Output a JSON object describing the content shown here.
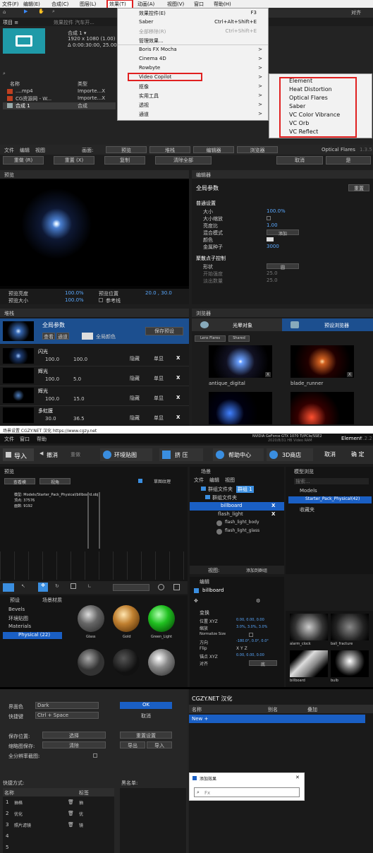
{
  "ae": {
    "menubar": [
      "文件(F)",
      "编辑(E)",
      "合成(C)",
      "图层(L)",
      "效果(T)",
      "动画(A)",
      "视图(V)",
      "窗口",
      "帮助(H)"
    ],
    "align_label": "对齐",
    "panel_tabs": [
      "项目 ≡",
      "效果控件 汽车开..."
    ],
    "comp_name": "合成 1 ▾",
    "comp_info1": "1920 x 1080 (1.00)",
    "comp_info2": "Δ 0:00:30:00, 25.00 fps",
    "search_glyph": "⌕",
    "col_name": "名称",
    "col_type": "类型",
    "rows": [
      {
        "n": "....mp4",
        "t": "Importe...X"
      },
      {
        "n": "CG资源网 - W...",
        "t": "Importe...X"
      },
      {
        "n": "合成 1",
        "t": "合成"
      }
    ],
    "effect_menu": [
      {
        "l": "效果控件(E)",
        "s": "F3"
      },
      {
        "l": "Saber",
        "s": "Ctrl+Alt+Shift+E"
      },
      {
        "l": "全部移除(R)",
        "s": "Ctrl+Shift+E"
      },
      {
        "l": "管理效果...",
        "s": ""
      },
      {
        "l": "Boris FX Mocha",
        "s": ">"
      },
      {
        "l": "Cinema 4D",
        "s": ">"
      },
      {
        "l": "Rowbyte",
        "s": ">"
      },
      {
        "l": "Video Copilot",
        "s": ">"
      },
      {
        "l": "抠像",
        "s": ">"
      },
      {
        "l": "实用工具",
        "s": ">"
      },
      {
        "l": "透视",
        "s": ">"
      },
      {
        "l": "通道",
        "s": ">"
      }
    ],
    "submenu": [
      "Element",
      "Heat Distortion",
      "Optical Flares",
      "Saber",
      "VC Color Vibrance",
      "VC Orb",
      "VC Reflect"
    ]
  },
  "of": {
    "menu": [
      "文件",
      "编辑",
      "视图"
    ],
    "topbar": [
      "画面:",
      "预览",
      "堆栈",
      "编辑器",
      "浏览器"
    ],
    "brand": "Optical Flares",
    "ver": "1.3.5",
    "btns": [
      "重做 (R)",
      "重置 (X)",
      "复制",
      "清除全部",
      "取消",
      "是"
    ],
    "preview_title": "预览",
    "stats": [
      {
        "l": "预览亮度",
        "v": "100.0%"
      },
      {
        "l": "预览位置",
        "v": "20.0 , 30.0"
      },
      {
        "l": "预览大小",
        "v": "100.0%"
      },
      {
        "l": "参考线",
        "v": ""
      }
    ],
    "stack_title": "堆栈",
    "global": {
      "label": "全局参数",
      "b1": "查看",
      "b2": "通道",
      "color": "全局颜色",
      "save": "保存预设"
    },
    "layers": [
      {
        "n": "闪光",
        "a": "100.0",
        "b": "100.0"
      },
      {
        "n": "辉光",
        "a": "100.0",
        "b": "5.0"
      },
      {
        "n": "辉光",
        "a": "100.0",
        "b": "15.0"
      },
      {
        "n": "多虹膜",
        "a": "30.0",
        "b": "36.5"
      }
    ],
    "layer_btns": {
      "hide": "隐藏",
      "solo": "单显",
      "x": "X"
    },
    "editor_title": "编辑器",
    "gp": "全局参数",
    "reset": "重置",
    "basic": "普通设置",
    "basic_rows": [
      {
        "l": "大小",
        "v": "100.0%"
      },
      {
        "l": "大小缩放",
        "v": ""
      },
      {
        "l": "亮度比",
        "v": "1.00"
      },
      {
        "l": "混合模式",
        "v": "添加"
      },
      {
        "l": "颜色",
        "v": ""
      },
      {
        "l": "金属种子",
        "v": "3000"
      }
    ],
    "light": "聚散点子控制",
    "light_rows": [
      {
        "l": "形状",
        "v": "圆"
      },
      {
        "l": "开始强度",
        "v": "25.0"
      },
      {
        "l": "淡出数量",
        "v": "25.0"
      }
    ],
    "browser_title": "浏览器",
    "tab1": "光晕对象",
    "tab2": "预设浏览器",
    "chips": [
      "Lens Flares",
      "Shared"
    ],
    "thumbs": [
      "antique_digital",
      "blade_runner",
      "",
      ""
    ]
  },
  "el": {
    "title": "场景设置 CGZY.NET 汉化 https://www.cgzy.net",
    "gpu": "NVIDIA GeForce GTX 1070 Ti/PCIe/SSE2",
    "gpu2": "2020/8/31 HB Video RAM",
    "menu": [
      "文件",
      "窗口",
      "帮助"
    ],
    "brand": "Element",
    "brand_ver": "2.2.2",
    "toolbar": [
      "导入",
      "撤消",
      "重做",
      "环境贴图",
      "挤 压",
      "帮助中心",
      "3D商店",
      "取消",
      "确 定"
    ],
    "preview": "预览",
    "dd1": "查看模",
    "dd2": "视角",
    "dd3": "草图纹理",
    "info": [
      "模型: Models/Starter_Pack_Physical/billboard.obj",
      "顶点: 37576",
      "面数: 9192"
    ],
    "scene": "场景",
    "scene_menu": [
      "文件",
      "编辑",
      "视图"
    ],
    "group1": "群组文件夹",
    "group1b": "群组 1",
    "group2": "群组文件夹",
    "bb": "billboard",
    "fl": "flash_light",
    "flb": "flash_light_body",
    "flg": "flash_light_glass",
    "view_label": "视图:",
    "add_group": "添加到群组",
    "model_browser": "模型浏览",
    "search_placeholder": "搜索...",
    "tree": [
      "Models",
      "Starter_Pack_Physical(42)",
      "收藏夹"
    ],
    "mat_tabs": [
      "预设",
      "场景材质"
    ],
    "mat_tree": [
      "Bevels",
      "环境贴图",
      "Materials",
      "Physical (22)"
    ],
    "mats": [
      "Glass",
      "Gold",
      "Green_Light",
      "",
      "",
      ""
    ],
    "edit": "编辑",
    "edit_item": "billboard",
    "transform": "变换",
    "props": [
      {
        "l": "位置 XYZ",
        "v": "0.00, 0.00, 0.00"
      },
      {
        "l": "缩放",
        "v": "3.0%, 3.0%, 3.0%"
      },
      {
        "l": "Normalize Size",
        "v": ""
      },
      {
        "l": "方向",
        "v": "-180.0°, 0.0°, 0.0°"
      },
      {
        "l": "Flip",
        "v": "X  Y  Z"
      },
      {
        "l": "锚点 XYZ",
        "v": "0.00, 0.00, 0.00"
      },
      {
        "l": "对齐",
        "v": "底"
      }
    ],
    "models": [
      "alarm_clock",
      "ball_fracture",
      "billboard",
      "bulb"
    ]
  },
  "prefs": {
    "ui_color_l": "界面色",
    "ui_color": "Dark",
    "hotkey_l": "快捷键",
    "hotkey": "Ctrl + Space",
    "ok": "OK",
    "cancel": "取消",
    "save_pos_l": "保存位置:",
    "choose": "选择",
    "reset_pos": "重置设置",
    "cache_l": "缩略图保存:",
    "clear": "清除",
    "export": "导出",
    "import": "导入",
    "full_l": "全分辨率截图:",
    "shortcuts_l": "快捷方式:",
    "head_name": "名称",
    "head_tag": "标签",
    "blacklist_l": "黑名单:",
    "shortcuts": [
      {
        "n": "抽格",
        "t": "抽"
      },
      {
        "n": "优化",
        "t": "优"
      },
      {
        "n": "照片滤镜",
        "t": "镜"
      },
      {
        "n": "",
        "t": ""
      },
      {
        "n": "",
        "t": ""
      }
    ],
    "right_title": "CGZY.NET 汉化",
    "rcols": [
      "名称",
      "别名",
      "叠加"
    ],
    "new_row": "New +",
    "add_effect": "添加效果",
    "fx_placeholder": "Fx"
  }
}
